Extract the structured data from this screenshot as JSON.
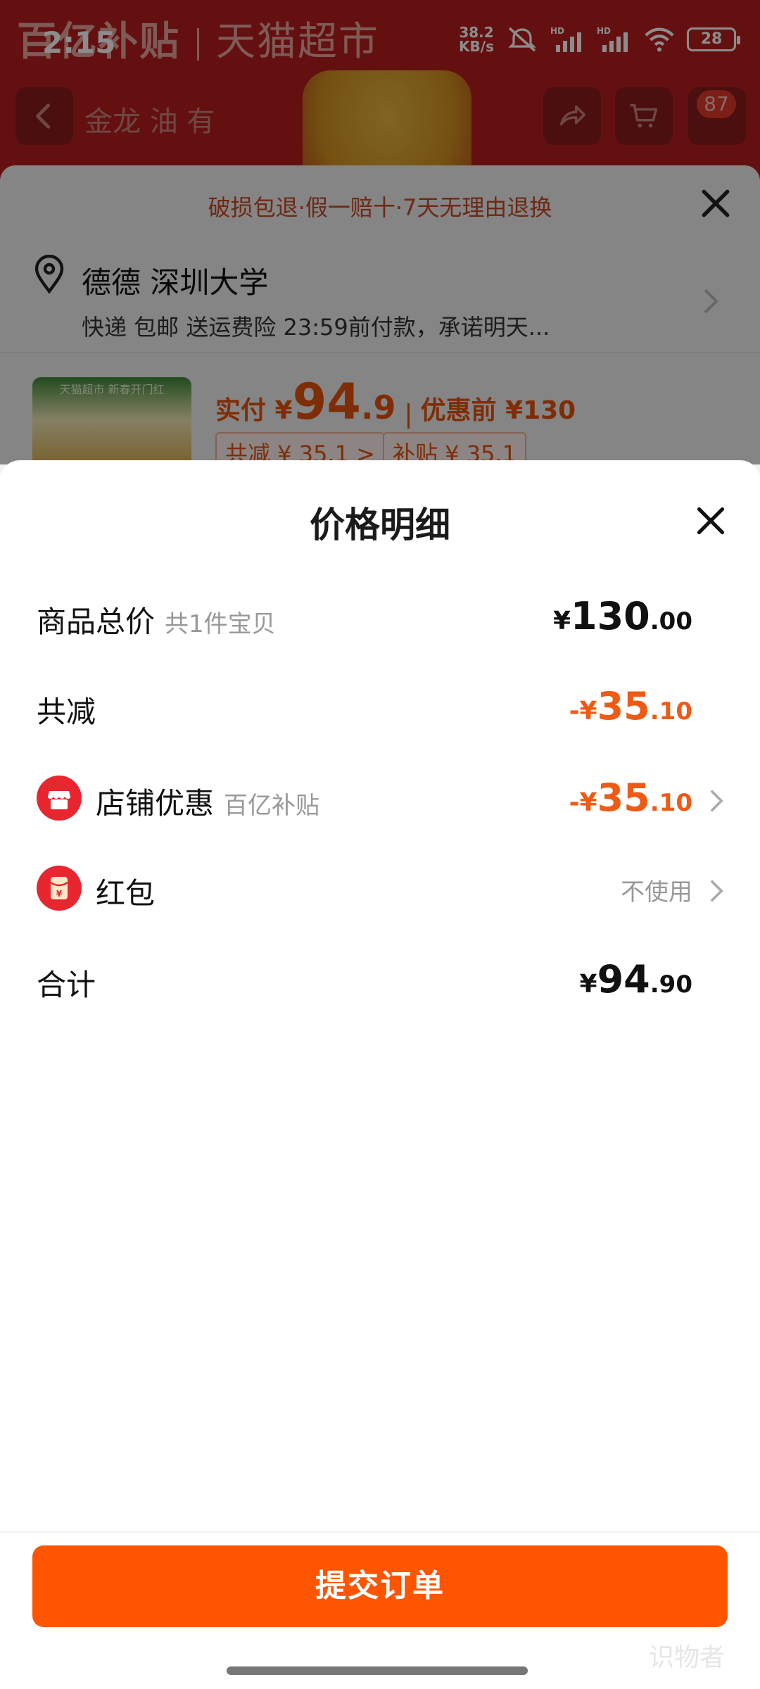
{
  "status_bar": {
    "time": "2:15",
    "net_speed_value": "38.2",
    "net_speed_unit": "KB/s",
    "battery": "28"
  },
  "background_page": {
    "banner_left": "百亿补贴",
    "banner_right": "天猫超市",
    "search_text": "金龙 油 有",
    "cart_count": "87",
    "guarantee": "破损包退·假一赔十·7天无理由退换",
    "address_name": "德德 深圳大学",
    "address_detail": "快递 包邮 送运费险 23:59前付款，承诺明天...",
    "thumb_shop": "天猫超市 新春开门红",
    "price_label": "实付 ¥",
    "price_int": "94",
    "price_dec": ".9",
    "price_before": "优惠前 ¥130",
    "tag_reduce": "共减 ¥ 35.1 >",
    "tag_subsidy": "补贴 ¥ 35.1"
  },
  "sheet": {
    "title": "价格明细",
    "rows": {
      "total": {
        "label": "商品总价",
        "sub": "共1件宝贝",
        "currency": "¥",
        "int": "130",
        "dec": ".00"
      },
      "reduce": {
        "label": "共减",
        "currency": "-¥",
        "int": "35",
        "dec": ".10"
      },
      "shop_discount": {
        "label": "店铺优惠",
        "sub": "百亿补贴",
        "currency": "-¥",
        "int": "35",
        "dec": ".10"
      },
      "red_packet": {
        "label": "红包",
        "value": "不使用"
      },
      "sum": {
        "label": "合计",
        "currency": "¥",
        "int": "94",
        "dec": ".90"
      }
    }
  },
  "submit_label": "提交订单",
  "watermark": "识物者",
  "colors": {
    "accent": "#ff5500",
    "discount": "#ef5a15",
    "icon_red": "#e8262f"
  },
  "icons": [
    "back-icon",
    "share-icon",
    "cart-icon",
    "close-icon",
    "location-pin-icon",
    "chevron-right-icon",
    "shop-icon",
    "red-packet-icon"
  ]
}
